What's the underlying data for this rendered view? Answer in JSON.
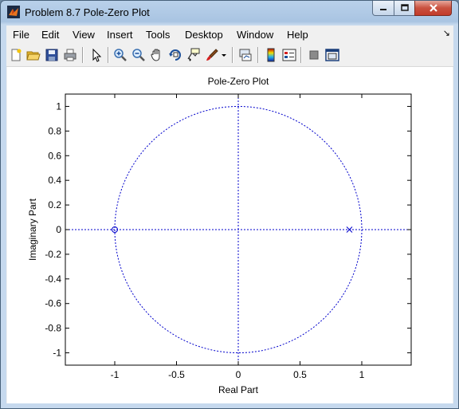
{
  "window": {
    "title": "Problem 8.7 Pole-Zero Plot"
  },
  "menu": [
    "File",
    "Edit",
    "View",
    "Insert",
    "Tools",
    "Desktop",
    "Window",
    "Help"
  ],
  "toolbar_icons": [
    "new-figure-icon",
    "open-file-icon",
    "save-icon",
    "print-icon",
    "pointer-icon",
    "zoom-in-icon",
    "zoom-out-icon",
    "pan-icon",
    "rotate-3d-icon",
    "data-cursor-icon",
    "brush-icon",
    "brush-dropdown-icon",
    "link-plot-icon",
    "colorbar-icon",
    "legend-icon",
    "hide-plot-tools-icon",
    "show-plot-tools-icon"
  ],
  "chart_data": {
    "type": "scatter",
    "title": "Pole-Zero Plot",
    "xlabel": "Real Part",
    "ylabel": "Imaginary Part",
    "xlim": [
      -1.4,
      1.4
    ],
    "ylim": [
      -1.1,
      1.1
    ],
    "xticks": [
      -1,
      -0.5,
      0,
      0.5,
      1
    ],
    "xtick_labels": [
      "-1",
      "-0.5",
      "0",
      "0.5",
      "1"
    ],
    "yticks": [
      -1,
      -0.8,
      -0.6,
      -0.4,
      -0.2,
      0,
      0.2,
      0.4,
      0.6,
      0.8,
      1
    ],
    "ytick_labels": [
      "-1",
      "-0.8",
      "-0.6",
      "-0.4",
      "-0.2",
      "0",
      "0.2",
      "0.4",
      "0.6",
      "0.8",
      "1"
    ],
    "unit_circle": {
      "radius": 1,
      "style": "dotted",
      "color": "#0000cc"
    },
    "zeros": [
      {
        "x": -1,
        "y": 0
      }
    ],
    "poles": [
      {
        "x": 0.9,
        "y": 0
      }
    ],
    "grid": false,
    "marker_color": "#0000cc"
  }
}
